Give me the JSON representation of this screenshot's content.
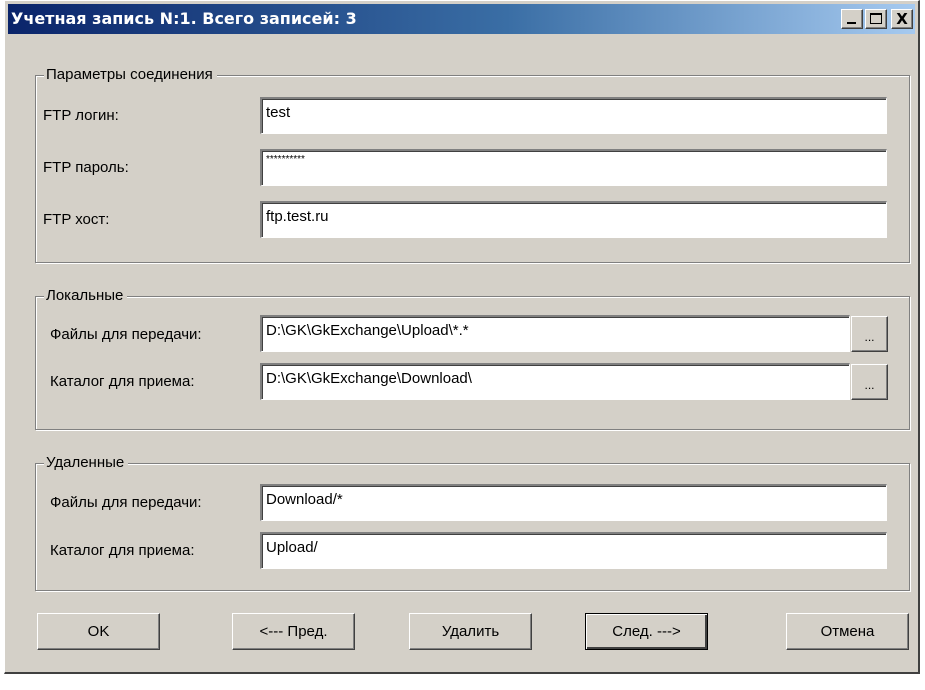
{
  "window": {
    "title": "Учетная запись N:1. Всего записей: 3",
    "title_buttons": {
      "minimize": "_",
      "maximize": "□",
      "close": "X"
    }
  },
  "connection": {
    "legend": "Параметры соединения",
    "login_label": "FTP логин:",
    "login_value": "test",
    "password_label": "FTP пароль:",
    "password_value": "**********",
    "host_label": "FTP хост:",
    "host_value": "ftp.test.ru"
  },
  "local": {
    "legend": "Локальные",
    "send_label": "Файлы для передачи:",
    "send_value": "D:\\GK\\GkExchange\\Upload\\*.*",
    "receive_label": "Каталог для приема:",
    "receive_value": "D:\\GK\\GkExchange\\Download\\",
    "browse_label": "..."
  },
  "remote": {
    "legend": "Удаленные",
    "send_label": "Файлы для передачи:",
    "send_value": "Download/*",
    "receive_label": "Каталог для приема:",
    "receive_value": "Upload/"
  },
  "buttons": {
    "ok": "OK",
    "prev": "<--- Пред.",
    "delete": "Удалить",
    "next": "След. --->",
    "cancel": "Отмена"
  },
  "colors": {
    "dialog_face": "#d4d0c8",
    "title_start": "#0a246a",
    "title_end": "#a6caf0",
    "field_bg": "#ffffff"
  }
}
